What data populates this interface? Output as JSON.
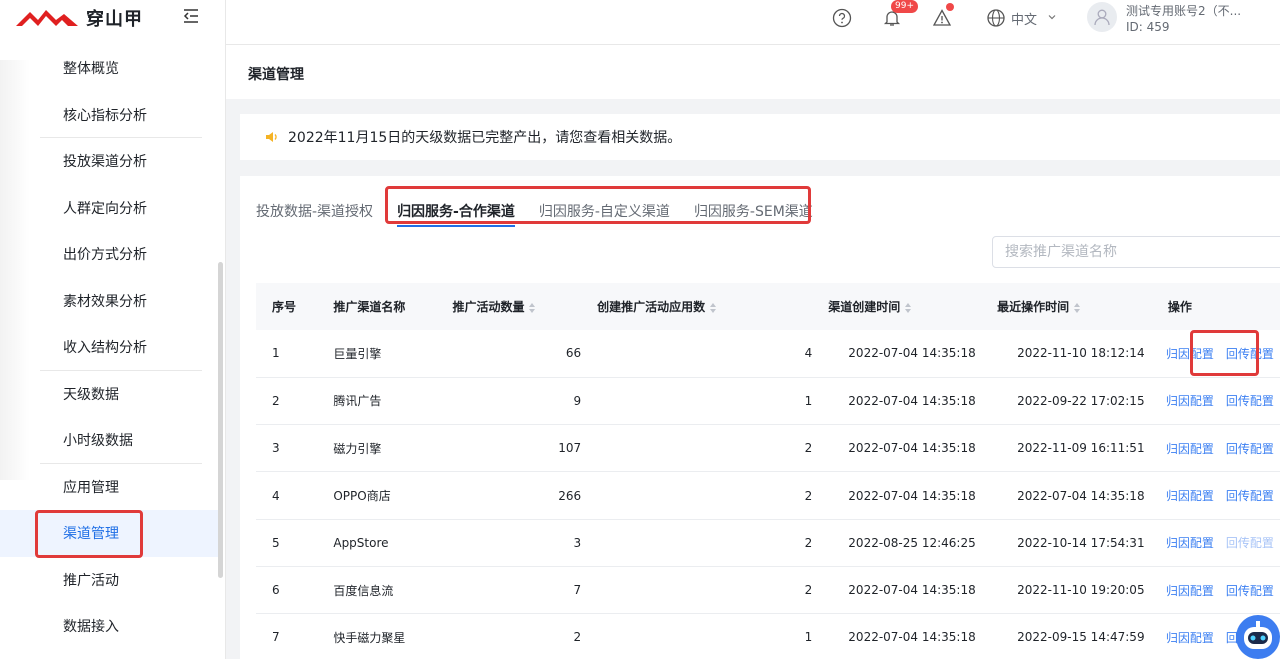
{
  "app": {
    "brand_name": "穿山甲"
  },
  "sidebar": {
    "items": [
      {
        "label": "整体概览"
      },
      {
        "label": "核心指标分析"
      },
      {
        "label": "投放渠道分析"
      },
      {
        "label": "人群定向分析"
      },
      {
        "label": "出价方式分析"
      },
      {
        "label": "素材效果分析"
      },
      {
        "label": "收入结构分析"
      },
      {
        "label": "天级数据"
      },
      {
        "label": "小时级数据"
      },
      {
        "label": "应用管理"
      },
      {
        "label": "渠道管理"
      },
      {
        "label": "推广活动"
      },
      {
        "label": "数据接入"
      }
    ],
    "active_index": 10
  },
  "header": {
    "notification_badge": "99+",
    "language": "中文",
    "account_name": "测试专用账号2（不...",
    "account_id": "ID: 459"
  },
  "page": {
    "title": "渠道管理",
    "notice": "2022年11月15日的天级数据已完整产出，请您查看相关数据。"
  },
  "tabs": [
    {
      "label": "投放数据-渠道授权"
    },
    {
      "label": "归因服务-合作渠道"
    },
    {
      "label": "归因服务-自定义渠道"
    },
    {
      "label": "归因服务-SEM渠道"
    }
  ],
  "search": {
    "placeholder": "搜索推广渠道名称"
  },
  "table": {
    "headers": {
      "index": "序号",
      "name": "推广渠道名称",
      "campaigns": "推广活动数量",
      "apps": "创建推广活动应用数",
      "created": "渠道创建时间",
      "updated": "最近操作时间",
      "ops": "操作"
    },
    "rows": [
      {
        "index": "1",
        "name": "巨量引擎",
        "campaigns": "66",
        "apps": "4",
        "created": "2022-07-04 14:35:18",
        "updated": "2022-11-10 18:12:14",
        "op1": "归因配置",
        "op2": "回传配置"
      },
      {
        "index": "2",
        "name": "腾讯广告",
        "campaigns": "9",
        "apps": "1",
        "created": "2022-07-04 14:35:18",
        "updated": "2022-09-22 17:02:15",
        "op1": "归因配置",
        "op2": "回传配置"
      },
      {
        "index": "3",
        "name": "磁力引擎",
        "campaigns": "107",
        "apps": "2",
        "created": "2022-07-04 14:35:18",
        "updated": "2022-11-09 16:11:51",
        "op1": "归因配置",
        "op2": "回传配置"
      },
      {
        "index": "4",
        "name": "OPPO商店",
        "campaigns": "266",
        "apps": "2",
        "created": "2022-07-04 14:35:18",
        "updated": "2022-07-04 14:35:18",
        "op1": "归因配置",
        "op2": "回传配置"
      },
      {
        "index": "5",
        "name": "AppStore",
        "campaigns": "3",
        "apps": "2",
        "created": "2022-08-25 12:46:25",
        "updated": "2022-10-14 17:54:31",
        "op1": "归因配置",
        "op2": "回传配置"
      },
      {
        "index": "6",
        "name": "百度信息流",
        "campaigns": "7",
        "apps": "2",
        "created": "2022-07-04 14:35:18",
        "updated": "2022-11-10 19:20:05",
        "op1": "归因配置",
        "op2": "回传配置"
      },
      {
        "index": "7",
        "name": "快手磁力聚星",
        "campaigns": "2",
        "apps": "1",
        "created": "2022-07-04 14:35:18",
        "updated": "2022-09-15 14:47:59",
        "op1": "归因配置",
        "op2": "回传配置"
      }
    ]
  },
  "colors": {
    "accent": "#1f6fe6",
    "link": "#3b7ff2",
    "highlight": "#e03a3a",
    "badge": "#f04848"
  }
}
